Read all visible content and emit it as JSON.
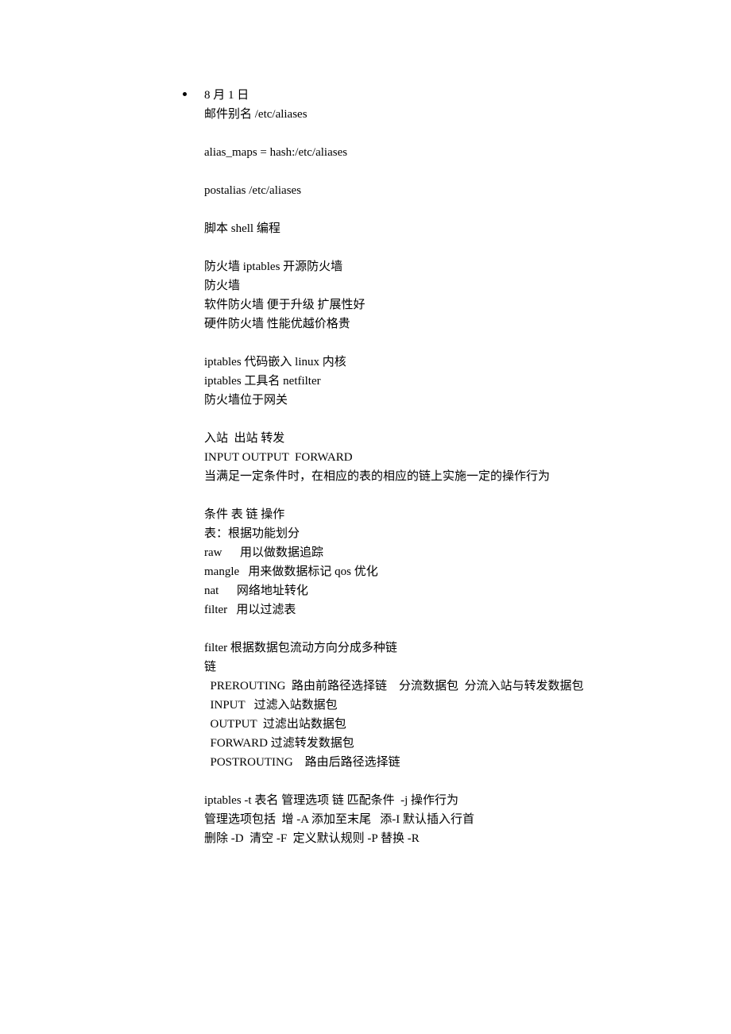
{
  "document": {
    "date": "8 月 1 日",
    "lines": [
      "邮件别名 /etc/aliases",
      "",
      "alias_maps = hash:/etc/aliases",
      "",
      "postalias /etc/aliases",
      "",
      "脚本 shell 编程",
      "",
      "防火墙 iptables 开源防火墙",
      "防火墙",
      "软件防火墙 便于升级 扩展性好",
      "硬件防火墙 性能优越价格贵",
      "",
      "iptables 代码嵌入 linux 内核",
      "iptables 工具名 netfilter",
      "防火墙位于网关",
      "",
      "入站  出站 转发",
      "INPUT OUTPUT  FORWARD",
      "当满足一定条件时，在相应的表的相应的链上实施一定的操作行为",
      "",
      "条件 表 链 操作",
      "表：根据功能划分",
      "raw      用以做数据追踪",
      "mangle   用来做数据标记 qos 优化",
      "nat      网络地址转化",
      "filter   用以过滤表",
      "",
      "filter 根据数据包流动方向分成多种链",
      "链",
      "  PREROUTING  路由前路径选择链    分流数据包  分流入站与转发数据包",
      "  INPUT   过滤入站数据包",
      "  OUTPUT  过滤出站数据包",
      "  FORWARD 过滤转发数据包",
      "  POSTROUTING    路由后路径选择链",
      "",
      "iptables -t 表名 管理选项 链 匹配条件  -j 操作行为",
      "管理选项包括  增 -A 添加至末尾   添-I 默认插入行首",
      "删除 -D  清空 -F  定义默认规则 -P 替换 -R"
    ]
  }
}
